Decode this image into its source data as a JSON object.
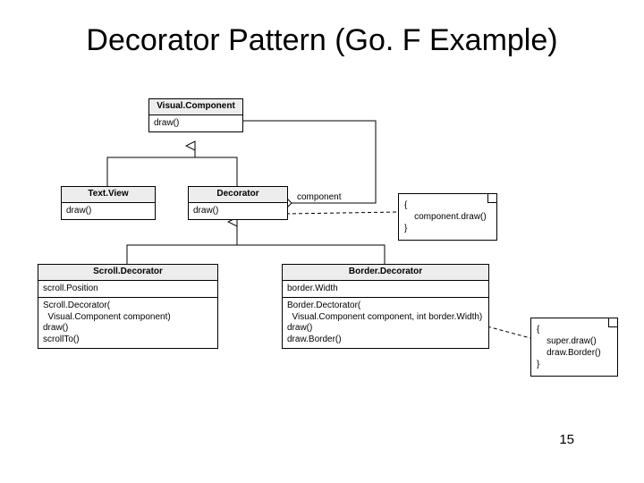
{
  "title": "Decorator Pattern (Go. F Example)",
  "page_number": "15",
  "classes": {
    "visual_component": {
      "name": "Visual.Component",
      "ops": [
        "draw()"
      ]
    },
    "text_view": {
      "name": "Text.View",
      "ops": [
        "draw()"
      ]
    },
    "decorator": {
      "name": "Decorator",
      "ops": [
        "draw()"
      ]
    },
    "scroll_decorator": {
      "name": "Scroll.Decorator",
      "attrs": [
        "scroll.Position"
      ],
      "ops": [
        "Scroll.Decorator(\n  Visual.Component component)",
        "draw()",
        "scrollTo()"
      ]
    },
    "border_decorator": {
      "name": "Border.Decorator",
      "attrs": [
        "border.Width"
      ],
      "ops": [
        "Border.Dectorator(\n  Visual.Component component, int border.Width)",
        "draw()",
        "draw.Border()"
      ]
    }
  },
  "notes": {
    "decorator_draw": {
      "lines": [
        "{",
        "    component.draw()",
        "}"
      ]
    },
    "border_draw": {
      "lines": [
        "{",
        "    super.draw()",
        "    draw.Border()",
        "}"
      ]
    }
  },
  "assoc": {
    "component_role": "component"
  }
}
